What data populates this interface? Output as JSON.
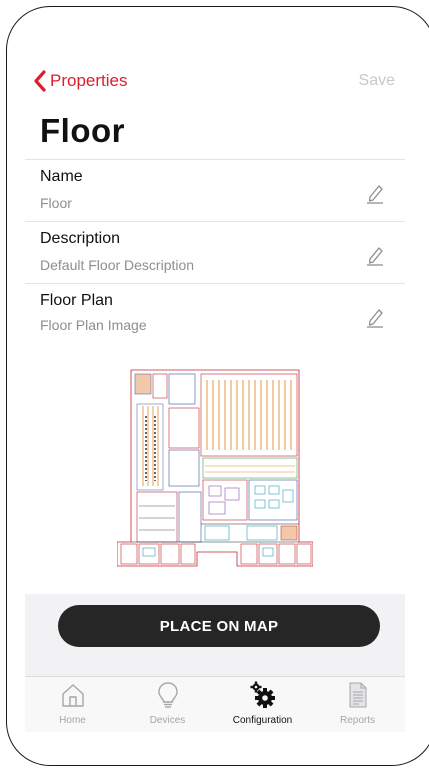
{
  "navbar": {
    "back_label": "Properties",
    "save_label": "Save"
  },
  "page": {
    "title": "Floor"
  },
  "properties": [
    {
      "label": "Name",
      "value": "Floor"
    },
    {
      "label": "Description",
      "value": "Default Floor Description"
    },
    {
      "label": "Floor Plan",
      "value": "Floor Plan Image"
    }
  ],
  "actions": {
    "place_on_map": "PLACE ON MAP"
  },
  "tabs": [
    {
      "label": "Home",
      "icon": "home-icon",
      "active": false
    },
    {
      "label": "Devices",
      "icon": "lightbulb-icon",
      "active": false
    },
    {
      "label": "Configuration",
      "icon": "gears-icon",
      "active": true
    },
    {
      "label": "Reports",
      "icon": "document-icon",
      "active": false
    }
  ],
  "colors": {
    "accent": "#d9202c",
    "button_dark": "#262626",
    "inactive": "#a6a6ab"
  }
}
